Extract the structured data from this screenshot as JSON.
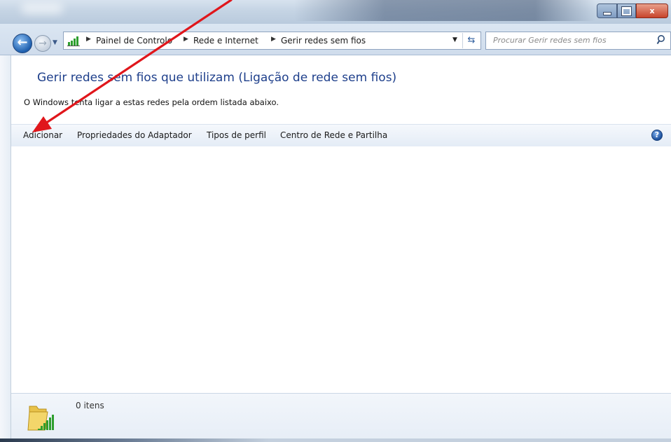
{
  "window": {
    "buttons": {
      "minimize_icon": "minimize-icon",
      "maximize_icon": "maximize-icon",
      "close_label": "x"
    }
  },
  "address_bar": {
    "breadcrumbs": [
      "Painel de Controlo",
      "Rede e Internet",
      "Gerir redes sem fios"
    ],
    "search_placeholder": "Procurar Gerir redes sem fios"
  },
  "page": {
    "title": "Gerir redes sem fios que utilizam (Ligação de rede sem fios)",
    "description": "O Windows tenta ligar a estas redes pela ordem listada abaixo."
  },
  "toolbar": {
    "items": [
      "Adicionar",
      "Propriedades do Adaptador",
      "Tipos de perfil",
      "Centro de Rede e Partilha"
    ],
    "help_label": "?"
  },
  "details": {
    "count_text": "0 itens"
  },
  "colors": {
    "title_blue": "#1e3f8b",
    "annotation_red": "#e0161b",
    "signal_green": "#2e9e2e"
  }
}
